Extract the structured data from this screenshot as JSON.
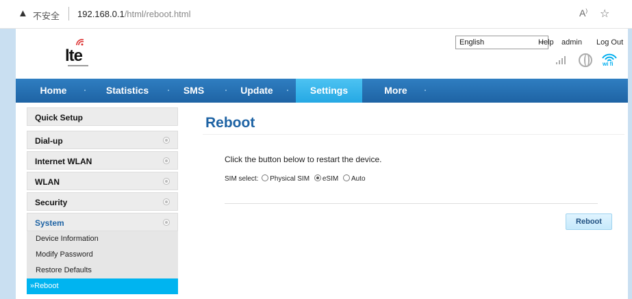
{
  "browser": {
    "insecure_label": "不安全",
    "url_host": "192.168.0.1",
    "url_path": "/html/reboot.html"
  },
  "header": {
    "logo_text": "lte",
    "language": "English",
    "help_label": "Help",
    "user_label": "admin",
    "logout_label": "Log Out",
    "wifi_label": "wi fi"
  },
  "nav": {
    "items": [
      {
        "label": "Home"
      },
      {
        "label": "Statistics"
      },
      {
        "label": "SMS"
      },
      {
        "label": "Update"
      },
      {
        "label": "Settings",
        "active": true
      },
      {
        "label": "More"
      }
    ]
  },
  "sidebar": {
    "items": [
      {
        "label": "Quick Setup"
      },
      {
        "label": "Dial-up"
      },
      {
        "label": "Internet WLAN"
      },
      {
        "label": "WLAN"
      },
      {
        "label": "Security"
      },
      {
        "label": "System",
        "expanded": true
      }
    ],
    "subitems": [
      {
        "label": "Device Information"
      },
      {
        "label": "Modify Password"
      },
      {
        "label": "Restore Defaults"
      },
      {
        "label": "Reboot",
        "active": true
      }
    ]
  },
  "main": {
    "title": "Reboot",
    "description": "Click the button below to restart the device.",
    "sim_select_label": "SIM select:",
    "sim_options": [
      {
        "label": "Physical SIM",
        "selected": false
      },
      {
        "label": "eSIM",
        "selected": true
      },
      {
        "label": "Auto",
        "selected": false
      }
    ],
    "reboot_button": "Reboot"
  },
  "colors": {
    "nav_blue": "#1e63a4",
    "active_tab": "#25a8e4",
    "active_subitem": "#00b4f0",
    "title_blue": "#1e63a4"
  }
}
